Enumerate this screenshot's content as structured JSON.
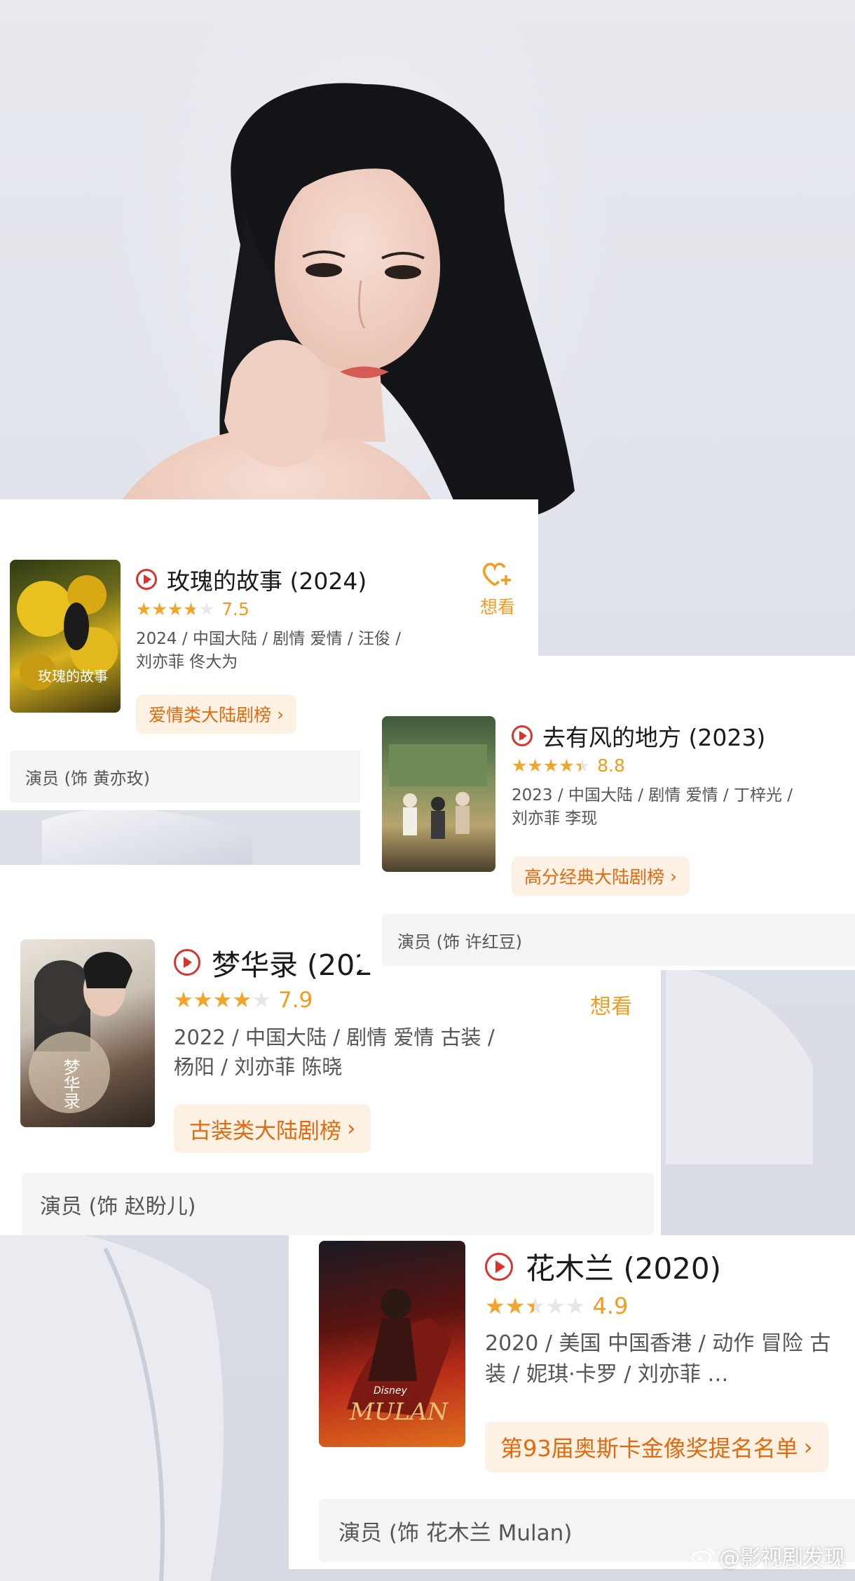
{
  "background": {
    "accent": "#d9342b",
    "score_color": "#f39b1e",
    "tag_bg": "#fdf1e3",
    "tag_text": "#e06a10"
  },
  "cards": [
    {
      "title": "玫瑰的故事 (2024)",
      "rating": 7.5,
      "stars_filled": 3.75,
      "score_text": "7.5",
      "meta": "2024 / 中国大陆 / 剧情 爱情 / 汪俊 / 刘亦菲 佟大为",
      "tag": "爱情类大陆剧榜",
      "role": "演员 (饰 黄亦玫)",
      "want_label": "想看",
      "poster_text": "玫瑰的故事"
    },
    {
      "title": "去有风的地方 (2023)",
      "rating": 8.8,
      "stars_filled": 4.4,
      "score_text": "8.8",
      "meta": "2023 / 中国大陆 / 剧情 爱情 / 丁梓光 / 刘亦菲 李现",
      "tag": "高分经典大陆剧榜",
      "role": "演员 (饰 许红豆)"
    },
    {
      "title": "梦华录 (202",
      "rating": 7.9,
      "stars_filled": 3.95,
      "score_text": "7.9",
      "meta": "2022 / 中国大陆 / 剧情 爱情 古装 / 杨阳 / 刘亦菲 陈晓",
      "tag": "古装类大陆剧榜",
      "role": "演员 (饰 赵盼儿)",
      "want_label": "想看",
      "poster_text": "梦华录"
    },
    {
      "title": "花木兰 (2020)",
      "rating": 4.9,
      "stars_filled": 2.45,
      "score_text": "4.9",
      "meta": "2020 / 美国 中国香港 / 动作 冒险 古装 / 妮琪·卡罗 / 刘亦菲 …",
      "tag": "第93届奥斯卡金像奖提名名单",
      "role": "演员 (饰 花木兰 Mulan)",
      "poster_text": "MULAN",
      "poster_brand": "Disney"
    }
  ],
  "watermark": "@影视剧发现"
}
